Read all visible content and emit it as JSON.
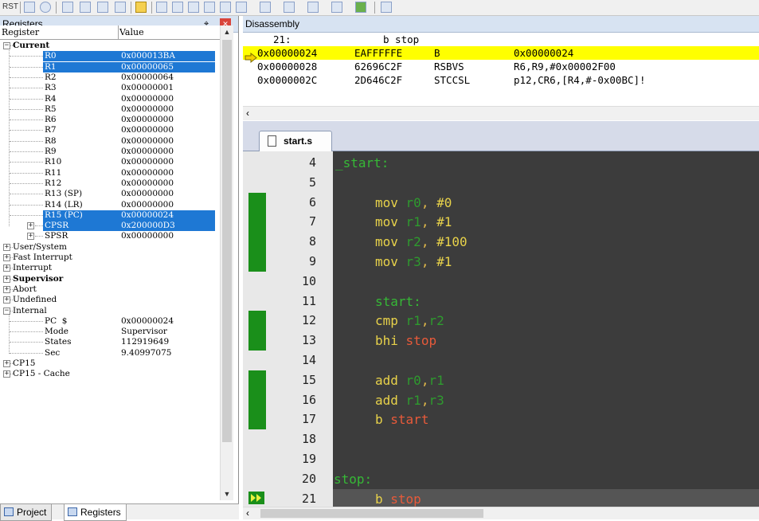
{
  "toolbar": {
    "rst_label": "RST",
    "icons": [
      "reset-icon",
      "step-icon",
      "run-icon",
      "step-into-icon",
      "step-over-icon",
      "step-out-icon",
      "run-to-cursor-icon",
      "arrow-icon",
      "command-window-icon",
      "disassembly-window-icon",
      "symbols-window-icon",
      "registers-window-icon",
      "call-stack-icon",
      "watch-window-icon",
      "memory-window-icon",
      "serial-window-icon",
      "analysis-icon",
      "trace-icon",
      "system-viewer-icon",
      "tools-icon"
    ]
  },
  "registers": {
    "title": "Registers",
    "pin_glyph": "⌖",
    "close_glyph": "✕",
    "col_register": "Register",
    "col_value": "Value",
    "rows": [
      {
        "name": "Current",
        "value": "",
        "bold": true,
        "level": 0,
        "expander": "-",
        "sel": false
      },
      {
        "name": "R0",
        "value": "0x000013BA",
        "level": 2,
        "sel": true
      },
      {
        "name": "R1",
        "value": "0x00000065",
        "level": 2,
        "sel": true
      },
      {
        "name": "R2",
        "value": "0x00000064",
        "level": 2,
        "sel": false
      },
      {
        "name": "R3",
        "value": "0x00000001",
        "level": 2,
        "sel": false
      },
      {
        "name": "R4",
        "value": "0x00000000",
        "level": 2,
        "sel": false
      },
      {
        "name": "R5",
        "value": "0x00000000",
        "level": 2,
        "sel": false
      },
      {
        "name": "R6",
        "value": "0x00000000",
        "level": 2,
        "sel": false
      },
      {
        "name": "R7",
        "value": "0x00000000",
        "level": 2,
        "sel": false
      },
      {
        "name": "R8",
        "value": "0x00000000",
        "level": 2,
        "sel": false
      },
      {
        "name": "R9",
        "value": "0x00000000",
        "level": 2,
        "sel": false
      },
      {
        "name": "R10",
        "value": "0x00000000",
        "level": 2,
        "sel": false
      },
      {
        "name": "R11",
        "value": "0x00000000",
        "level": 2,
        "sel": false
      },
      {
        "name": "R12",
        "value": "0x00000000",
        "level": 2,
        "sel": false
      },
      {
        "name": "R13 (SP)",
        "value": "0x00000000",
        "level": 2,
        "sel": false
      },
      {
        "name": "R14 (LR)",
        "value": "0x00000000",
        "level": 2,
        "sel": false
      },
      {
        "name": "R15 (PC)",
        "value": "0x00000024",
        "level": 2,
        "sel": true
      },
      {
        "name": "CPSR",
        "value": "0x200000D3",
        "level": 2,
        "sel": true,
        "expander": "+"
      },
      {
        "name": "SPSR",
        "value": "0x00000000",
        "level": 2,
        "sel": false,
        "expander": "+"
      },
      {
        "name": "User/System",
        "value": "",
        "level": 0,
        "expander": "+"
      },
      {
        "name": "Fast Interrupt",
        "value": "",
        "level": 0,
        "expander": "+"
      },
      {
        "name": "Interrupt",
        "value": "",
        "level": 0,
        "expander": "+"
      },
      {
        "name": "Supervisor",
        "value": "",
        "level": 0,
        "expander": "+",
        "bold": true
      },
      {
        "name": "Abort",
        "value": "",
        "level": 0,
        "expander": "+"
      },
      {
        "name": "Undefined",
        "value": "",
        "level": 0,
        "expander": "+"
      },
      {
        "name": "Internal",
        "value": "",
        "level": 0,
        "expander": "-"
      },
      {
        "name": "PC  $",
        "value": "0x00000024",
        "level": 2
      },
      {
        "name": "Mode",
        "value": "Supervisor",
        "level": 2
      },
      {
        "name": "States",
        "value": "112919649",
        "level": 2
      },
      {
        "name": "Sec",
        "value": "9.40997075",
        "level": 2
      },
      {
        "name": "CP15",
        "value": "",
        "level": 0,
        "expander": "+"
      },
      {
        "name": "CP15 - Cache",
        "value": "",
        "level": 0,
        "expander": "+"
      }
    ],
    "tabs": [
      {
        "label": "Project",
        "active": false
      },
      {
        "label": "Registers",
        "active": true
      }
    ]
  },
  "disassembly": {
    "title": "Disassembly",
    "source_line_no": "21:",
    "source_line_text": "b stop",
    "lines": [
      {
        "addr": "0x00000024",
        "opcode": "EAFFFFFE",
        "mnemonic": "B",
        "operands": "0x00000024",
        "current": true
      },
      {
        "addr": "0x00000028",
        "opcode": "62696C2F",
        "mnemonic": "RSBVS",
        "operands": "R6,R9,#0x00002F00",
        "current": false
      },
      {
        "addr": "0x0000002C",
        "opcode": "2D646C2F",
        "mnemonic": "STCCSL",
        "operands": "p12,CR6,[R4,#-0x00BC]!",
        "current": false
      }
    ]
  },
  "editor": {
    "tab_label": "start.s",
    "lines": [
      {
        "no": "4",
        "code": "_start:",
        "kind": "label",
        "cov": false
      },
      {
        "no": "5",
        "code": "",
        "kind": "blank",
        "cov": false
      },
      {
        "no": "6",
        "instr": "mov",
        "reg": "r0",
        "imm": "#0",
        "cov": true
      },
      {
        "no": "7",
        "instr": "mov",
        "reg": "r1",
        "imm": "#1",
        "cov": true
      },
      {
        "no": "8",
        "instr": "mov",
        "reg": "r2",
        "imm": "#100",
        "cov": true
      },
      {
        "no": "9",
        "instr": "mov",
        "reg": "r3",
        "imm": "#1",
        "cov": true
      },
      {
        "no": "10",
        "code": "",
        "kind": "blank",
        "cov": false
      },
      {
        "no": "11",
        "code": "start:",
        "kind": "label",
        "indent": true,
        "cov": false
      },
      {
        "no": "12",
        "instr": "cmp",
        "reg": "r1",
        "reg2": "r2",
        "cov": true
      },
      {
        "no": "13",
        "instr": "bhi",
        "target": "stop",
        "cov": true
      },
      {
        "no": "14",
        "code": "",
        "kind": "blank",
        "cov": false
      },
      {
        "no": "15",
        "instr": "add",
        "reg": "r0",
        "reg2": "r1",
        "cov": true
      },
      {
        "no": "16",
        "instr": "add",
        "reg": "r1",
        "reg2": "r3",
        "cov": true
      },
      {
        "no": "17",
        "instr": "b",
        "target": "start",
        "cov": true
      },
      {
        "no": "18",
        "code": "",
        "kind": "blank",
        "cov": false
      },
      {
        "no": "19",
        "code": "",
        "kind": "blank",
        "cov": false
      },
      {
        "no": "20",
        "code": "stop:",
        "kind": "label",
        "cov": false
      },
      {
        "no": "21",
        "instr": "b",
        "target": "stop",
        "cov": false,
        "current": true
      }
    ]
  },
  "colors": {
    "selection": "#1e78d4",
    "current_line": "#ffff00",
    "coverage": "#1a8f1a",
    "editor_bg": "#3c3c3c"
  }
}
